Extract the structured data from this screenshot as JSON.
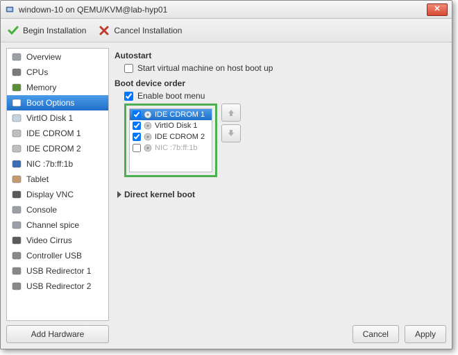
{
  "window": {
    "title": "windown-10 on QEMU/KVM@lab-hyp01"
  },
  "toolbar": {
    "begin": "Begin Installation",
    "cancel": "Cancel Installation"
  },
  "sidebar": {
    "items": [
      {
        "label": "Overview",
        "iconColor": "#9aa0a6"
      },
      {
        "label": "CPUs",
        "iconColor": "#7a7a7a"
      },
      {
        "label": "Memory",
        "iconColor": "#5a8f3a"
      },
      {
        "label": "Boot Options",
        "iconColor": "#ffffff",
        "selected": true
      },
      {
        "label": "VirtIO Disk 1",
        "iconColor": "#c5d4df"
      },
      {
        "label": "IDE CDROM 1",
        "iconColor": "#bfbfbf"
      },
      {
        "label": "IDE CDROM 2",
        "iconColor": "#bfbfbf"
      },
      {
        "label": "NIC :7b:ff:1b",
        "iconColor": "#3a6fb5"
      },
      {
        "label": "Tablet",
        "iconColor": "#c59b6d"
      },
      {
        "label": "Display VNC",
        "iconColor": "#5a5a5a"
      },
      {
        "label": "Console",
        "iconColor": "#9aa0a6"
      },
      {
        "label": "Channel spice",
        "iconColor": "#9aa0a6"
      },
      {
        "label": "Video Cirrus",
        "iconColor": "#5a5a5a"
      },
      {
        "label": "Controller USB",
        "iconColor": "#888888"
      },
      {
        "label": "USB Redirector 1",
        "iconColor": "#888888"
      },
      {
        "label": "USB Redirector 2",
        "iconColor": "#888888"
      }
    ],
    "addHardware": "Add Hardware"
  },
  "content": {
    "autostart": {
      "heading": "Autostart",
      "optionLabel": "Start virtual machine on host boot up",
      "checked": false
    },
    "bootOrder": {
      "heading": "Boot device order",
      "enableMenuLabel": "Enable boot menu",
      "enableMenuChecked": true,
      "devices": [
        {
          "label": "IDE CDROM 1",
          "checked": true,
          "selected": true,
          "dim": false
        },
        {
          "label": "VirtIO Disk 1",
          "checked": true,
          "selected": false,
          "dim": false
        },
        {
          "label": "IDE CDROM 2",
          "checked": true,
          "selected": false,
          "dim": false
        },
        {
          "label": "NIC :7b:ff:1b",
          "checked": false,
          "selected": false,
          "dim": true
        }
      ]
    },
    "directKernel": "Direct kernel boot"
  },
  "footer": {
    "cancel": "Cancel",
    "apply": "Apply"
  }
}
